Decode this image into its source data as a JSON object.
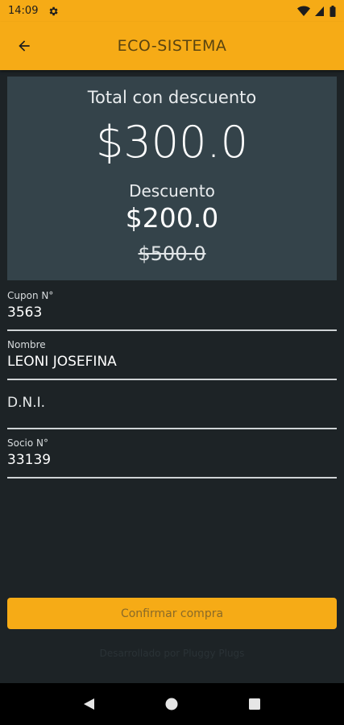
{
  "status_bar": {
    "time": "14:09"
  },
  "app_bar": {
    "title": "ECO-SISTEMA"
  },
  "summary": {
    "total_label": "Total con descuento",
    "total_value": "$300.0",
    "discount_label": "Descuento",
    "discount_value": "$200.0",
    "original_price": "$500.0"
  },
  "fields": {
    "cupon": {
      "label": "Cupon N°",
      "value": "3563"
    },
    "nombre": {
      "label": "Nombre",
      "value": "LEONI JOSEFINA"
    },
    "dni": {
      "placeholder": "D.N.I."
    },
    "socio": {
      "label": "Socio N°",
      "value": "33139"
    }
  },
  "confirm_label": "Confirmar compra",
  "footer_note": "Desarrollado por Pluggy Plugs",
  "colors": {
    "accent": "#f6ab16",
    "background": "#1d2326",
    "card": "#34434a"
  }
}
